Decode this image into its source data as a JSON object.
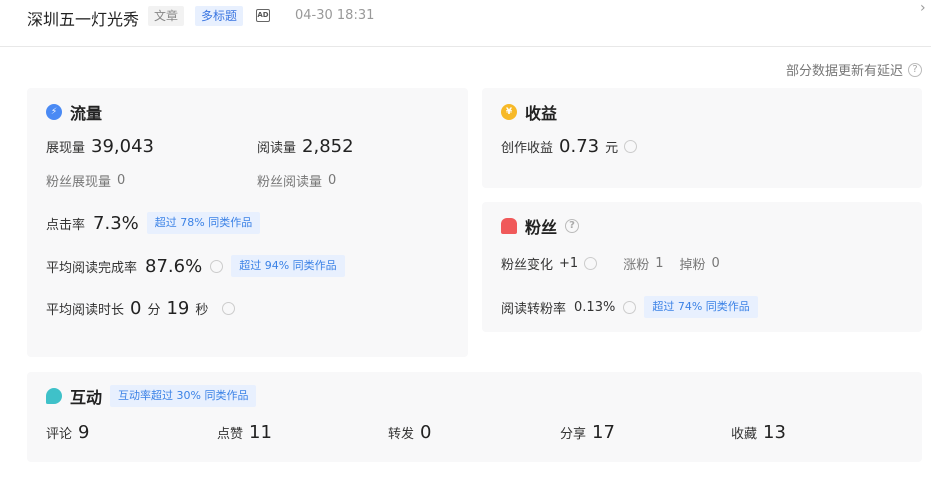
{
  "header": {
    "title": "深圳五一灯光秀",
    "tag_type": "文章",
    "tag_multi": "多标题",
    "ad_label": "AD",
    "time": "04-30 18:31",
    "chevron": "›"
  },
  "note": "部分数据更新有延迟",
  "traffic": {
    "title": "流量",
    "impressions_label": "展现量",
    "impressions": "39,043",
    "reads_label": "阅读量",
    "reads": "2,852",
    "fan_impr_label": "粉丝展现量",
    "fan_impr": "0",
    "fan_reads_label": "粉丝阅读量",
    "fan_reads": "0",
    "ctr_label": "点击率",
    "ctr": "7.3%",
    "ctr_badge": "超过 78% 同类作品",
    "completion_label": "平均阅读完成率",
    "completion": "87.6%",
    "completion_badge": "超过 94% 同类作品",
    "duration_label": "平均阅读时长",
    "dur_min": "0",
    "min_unit": "分",
    "dur_sec": "19",
    "sec_unit": "秒"
  },
  "income": {
    "title": "收益",
    "label": "创作收益",
    "value": "0.73",
    "unit": "元"
  },
  "fans": {
    "title": "粉丝",
    "change_label": "粉丝变化",
    "change": "+1",
    "gain_label": "涨粉",
    "gain": "1",
    "loss_label": "掉粉",
    "loss": "0",
    "conv_label": "阅读转粉率",
    "conv": "0.13%",
    "conv_badge": "超过 74% 同类作品"
  },
  "interact": {
    "title": "互动",
    "badge": "互动率超过 30% 同类作品",
    "items": [
      {
        "label": "评论",
        "value": "9"
      },
      {
        "label": "点赞",
        "value": "11"
      },
      {
        "label": "转发",
        "value": "0"
      },
      {
        "label": "分享",
        "value": "17"
      },
      {
        "label": "收藏",
        "value": "13"
      }
    ]
  },
  "colors": {
    "accent": "#3b82e6",
    "traffic": "#4a8af4",
    "income": "#f7b928",
    "fans": "#f0595a",
    "interact": "#3fc1c9"
  }
}
